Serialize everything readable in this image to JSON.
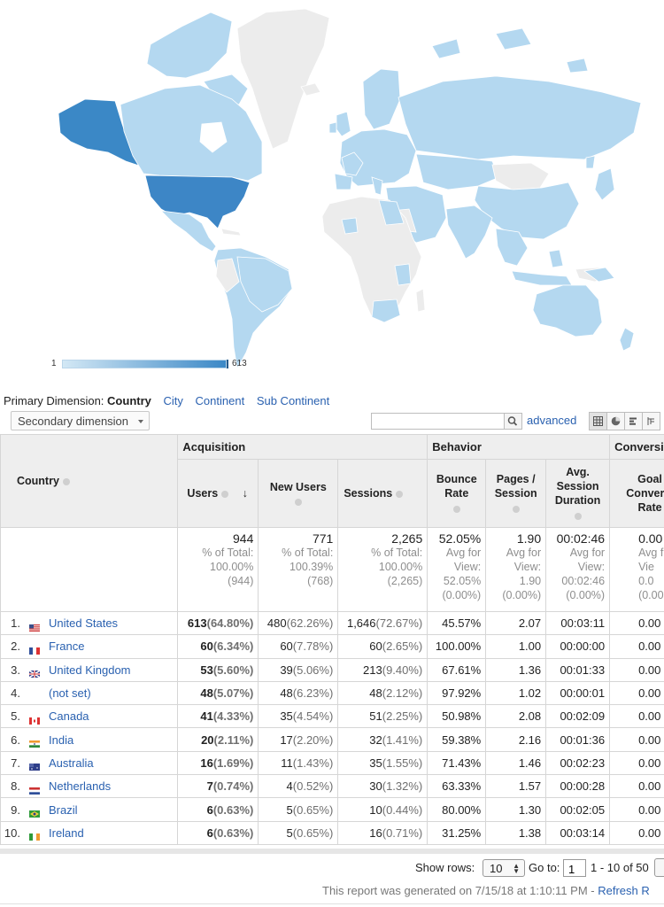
{
  "colors": {
    "high": "#3b88c6",
    "top": "#3d86c6",
    "low": "#b4d8f0",
    "none": "#ececec",
    "link": "#2a61b0"
  },
  "legend": {
    "min": "1",
    "max": "613"
  },
  "primary_dimension": {
    "label": "Primary Dimension:",
    "current": "Country",
    "options": [
      "City",
      "Continent",
      "Sub Continent"
    ]
  },
  "toolbar": {
    "secondary_dimension": "Secondary dimension",
    "search_placeholder": "",
    "advanced": "advanced",
    "search_icon": "magnifier-icon",
    "view_icons": [
      "table-icon",
      "pie-icon",
      "bar-icon",
      "pivot-icon"
    ]
  },
  "table": {
    "groups": {
      "acquisition": "Acquisition",
      "behavior": "Behavior",
      "conversions": "Conversi"
    },
    "headers": {
      "country": "Country",
      "users": "Users",
      "new_users": "New Users",
      "sessions": "Sessions",
      "bounce_rate": [
        "Bounce",
        "Rate"
      ],
      "pages_session": [
        "Pages /",
        "Session"
      ],
      "avg_duration": [
        "Avg.",
        "Session",
        "Duration"
      ],
      "goal_rate": [
        "Goal",
        "Conversi",
        "Rate"
      ]
    },
    "totals": {
      "users": {
        "value": "944",
        "l1": "% of Total:",
        "l2": "100.00%",
        "l3": "(944)"
      },
      "new_users": {
        "value": "771",
        "l1": "% of Total:",
        "l2": "100.39%",
        "l3": "(768)"
      },
      "sessions": {
        "value": "2,265",
        "l1": "% of Total:",
        "l2": "100.00%",
        "l3": "(2,265)"
      },
      "bounce": {
        "value": "52.05%",
        "l1": "Avg for",
        "l2": "View:",
        "l3": "52.05%",
        "l4": "(0.00%)"
      },
      "pages": {
        "value": "1.90",
        "l1": "Avg for",
        "l2": "View:",
        "l3": "1.90",
        "l4": "(0.00%)"
      },
      "duration": {
        "value": "00:02:46",
        "l1": "Avg for",
        "l2": "View:",
        "l3": "00:02:46",
        "l4": "(0.00%)"
      },
      "goal": {
        "value": "0.00",
        "l1": "Avg f",
        "l2": "Vie",
        "l3": "0.0",
        "l4": "(0.00"
      }
    },
    "rows": [
      {
        "rank": "1.",
        "country": "United States",
        "flag": "us",
        "users": "613",
        "users_pct": "(64.80%)",
        "new_users": "480",
        "new_pct": "(62.26%)",
        "sessions": "1,646",
        "sess_pct": "(72.67%)",
        "bounce": "45.57%",
        "pages": "2.07",
        "duration": "00:03:11",
        "goal": "0.00"
      },
      {
        "rank": "2.",
        "country": "France",
        "flag": "fr",
        "users": "60",
        "users_pct": "(6.34%)",
        "new_users": "60",
        "new_pct": "(7.78%)",
        "sessions": "60",
        "sess_pct": "(2.65%)",
        "bounce": "100.00%",
        "pages": "1.00",
        "duration": "00:00:00",
        "goal": "0.00"
      },
      {
        "rank": "3.",
        "country": "United Kingdom",
        "flag": "gb",
        "users": "53",
        "users_pct": "(5.60%)",
        "new_users": "39",
        "new_pct": "(5.06%)",
        "sessions": "213",
        "sess_pct": "(9.40%)",
        "bounce": "67.61%",
        "pages": "1.36",
        "duration": "00:01:33",
        "goal": "0.00"
      },
      {
        "rank": "4.",
        "country": "(not set)",
        "flag": "",
        "users": "48",
        "users_pct": "(5.07%)",
        "new_users": "48",
        "new_pct": "(6.23%)",
        "sessions": "48",
        "sess_pct": "(2.12%)",
        "bounce": "97.92%",
        "pages": "1.02",
        "duration": "00:00:01",
        "goal": "0.00"
      },
      {
        "rank": "5.",
        "country": "Canada",
        "flag": "ca",
        "users": "41",
        "users_pct": "(4.33%)",
        "new_users": "35",
        "new_pct": "(4.54%)",
        "sessions": "51",
        "sess_pct": "(2.25%)",
        "bounce": "50.98%",
        "pages": "2.08",
        "duration": "00:02:09",
        "goal": "0.00"
      },
      {
        "rank": "6.",
        "country": "India",
        "flag": "in",
        "users": "20",
        "users_pct": "(2.11%)",
        "new_users": "17",
        "new_pct": "(2.20%)",
        "sessions": "32",
        "sess_pct": "(1.41%)",
        "bounce": "59.38%",
        "pages": "2.16",
        "duration": "00:01:36",
        "goal": "0.00"
      },
      {
        "rank": "7.",
        "country": "Australia",
        "flag": "au",
        "users": "16",
        "users_pct": "(1.69%)",
        "new_users": "11",
        "new_pct": "(1.43%)",
        "sessions": "35",
        "sess_pct": "(1.55%)",
        "bounce": "71.43%",
        "pages": "1.46",
        "duration": "00:02:23",
        "goal": "0.00"
      },
      {
        "rank": "8.",
        "country": "Netherlands",
        "flag": "nl",
        "users": "7",
        "users_pct": "(0.74%)",
        "new_users": "4",
        "new_pct": "(0.52%)",
        "sessions": "30",
        "sess_pct": "(1.32%)",
        "bounce": "63.33%",
        "pages": "1.57",
        "duration": "00:00:28",
        "goal": "0.00"
      },
      {
        "rank": "9.",
        "country": "Brazil",
        "flag": "br",
        "users": "6",
        "users_pct": "(0.63%)",
        "new_users": "5",
        "new_pct": "(0.65%)",
        "sessions": "10",
        "sess_pct": "(0.44%)",
        "bounce": "80.00%",
        "pages": "1.30",
        "duration": "00:02:05",
        "goal": "0.00"
      },
      {
        "rank": "10.",
        "country": "Ireland",
        "flag": "ie",
        "users": "6",
        "users_pct": "(0.63%)",
        "new_users": "5",
        "new_pct": "(0.65%)",
        "sessions": "16",
        "sess_pct": "(0.71%)",
        "bounce": "31.25%",
        "pages": "1.38",
        "duration": "00:03:14",
        "goal": "0.00"
      }
    ]
  },
  "footer": {
    "show_rows_label": "Show rows:",
    "rows_value": "10",
    "goto_label": "Go to:",
    "goto_value": "1",
    "range": "1 - 10 of 50",
    "generated": "This report was generated on 7/15/18 at 1:10:11 PM - ",
    "refresh": "Refresh R"
  }
}
